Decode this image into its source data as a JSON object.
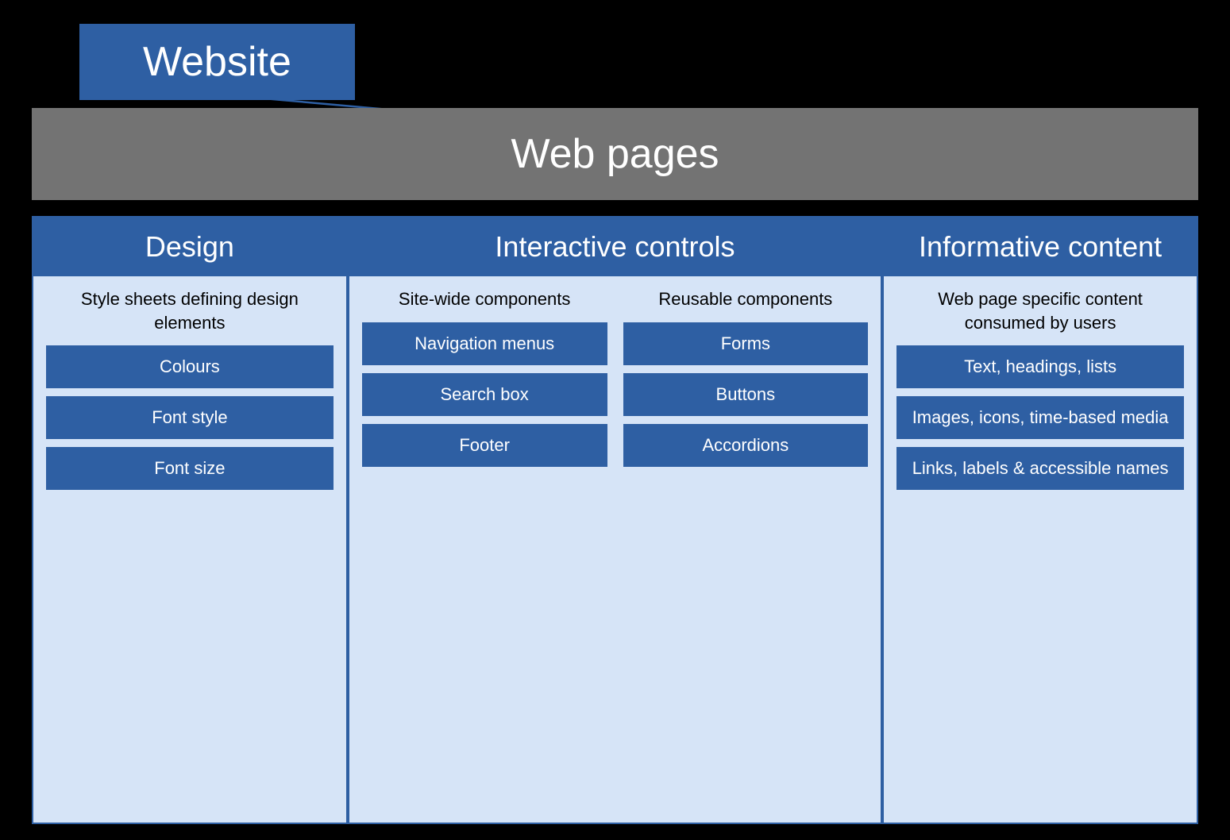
{
  "website": {
    "label": "Website"
  },
  "webpages": {
    "label": "Web pages"
  },
  "design": {
    "header": "Design",
    "description": "Style sheets defining design elements",
    "items": [
      "Colours",
      "Font style",
      "Font size"
    ]
  },
  "interactive_controls": {
    "header": "Interactive controls",
    "site_wide": {
      "description": "Site-wide components",
      "items": [
        "Navigation menus",
        "Search box",
        "Footer"
      ]
    },
    "reusable": {
      "description": "Reusable components",
      "items": [
        "Forms",
        "Buttons",
        "Accordions"
      ]
    }
  },
  "informative_content": {
    "header": "Informative content",
    "description": "Web page specific content consumed by users",
    "items": [
      "Text, headings, lists",
      "Images, icons, time-based media",
      "Links, labels & accessible names"
    ]
  }
}
